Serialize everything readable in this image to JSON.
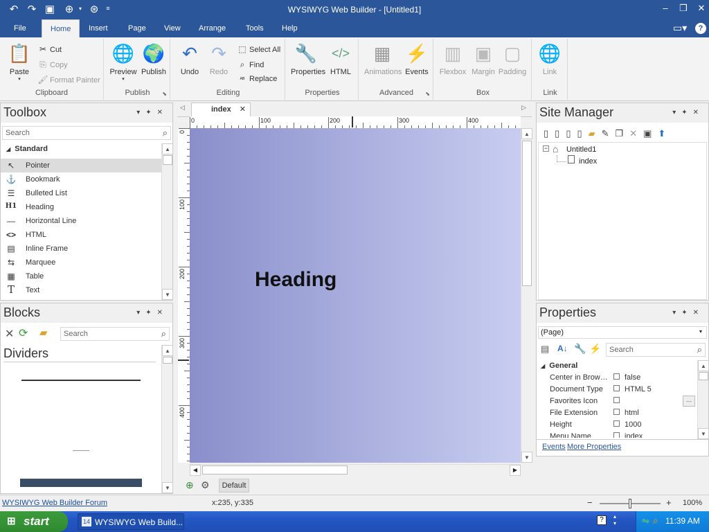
{
  "titlebar": {
    "title": "WYSIWYG Web Builder - [Untitled1]",
    "icons": [
      "undo-icon",
      "redo-icon",
      "save-icon",
      "preview-icon",
      "publish-icon"
    ],
    "controls": [
      "minimize",
      "restore",
      "close"
    ]
  },
  "tabs": [
    "File",
    "Home",
    "Insert",
    "Page",
    "View",
    "Arrange",
    "Tools",
    "Help"
  ],
  "active_tab": "Home",
  "ribbon": {
    "clipboard": {
      "paste": "Paste",
      "cut": "Cut",
      "copy": "Copy",
      "format_painter": "Format Painter",
      "label": "Clipboard"
    },
    "publish": {
      "preview": "Preview",
      "publish": "Publish",
      "label": "Publish"
    },
    "editing": {
      "undo": "Undo",
      "redo": "Redo",
      "select_all": "Select All",
      "find": "Find",
      "replace": "Replace",
      "label": "Editing"
    },
    "properties": {
      "properties": "Properties",
      "html": "HTML",
      "label": "Properties"
    },
    "advanced": {
      "animations": "Animations",
      "events": "Events",
      "label": "Advanced"
    },
    "box": {
      "flexbox": "Flexbox",
      "margin": "Margin",
      "padding": "Padding",
      "label": "Box"
    },
    "link": {
      "link": "Link",
      "label": "Link"
    }
  },
  "toolbox": {
    "title": "Toolbox",
    "search_placeholder": "Search",
    "category": "Standard",
    "items": [
      "Pointer",
      "Bookmark",
      "Bulleted List",
      "Heading",
      "Horizontal Line",
      "HTML",
      "Inline Frame",
      "Marquee",
      "Table",
      "Text"
    ]
  },
  "blocks": {
    "title": "Blocks",
    "search_placeholder": "Search",
    "category": "Dividers"
  },
  "editor": {
    "tab": "index",
    "ruler_h": [
      "0",
      "100",
      "200",
      "300",
      "400"
    ],
    "ruler_v": [
      "0",
      "100",
      "200",
      "300",
      "400"
    ],
    "heading": "Heading",
    "bottom_tab": "Default"
  },
  "site_manager": {
    "title": "Site Manager",
    "root": "Untitled1",
    "page": "index"
  },
  "properties": {
    "title": "Properties",
    "selector": "(Page)",
    "search_placeholder": "Search",
    "section": "General",
    "rows": [
      {
        "name": "Center in Brow…",
        "value": "false"
      },
      {
        "name": "Document Type",
        "value": "HTML 5"
      },
      {
        "name": "Favorites Icon",
        "value": ""
      },
      {
        "name": "File Extension",
        "value": "html"
      },
      {
        "name": "Height",
        "value": "1000"
      },
      {
        "name": "Menu Name",
        "value": "index"
      }
    ],
    "links": {
      "events": "Events",
      "more": "More Properties"
    }
  },
  "status": {
    "forum_link": "WYSIWYG Web Builder Forum",
    "coords": "x:235, y:335",
    "zoom": "100%",
    "zoom_level": 0.5
  },
  "taskbar": {
    "start": "start",
    "task": "WYSIWYG Web Build...",
    "time": "11:39 AM"
  }
}
